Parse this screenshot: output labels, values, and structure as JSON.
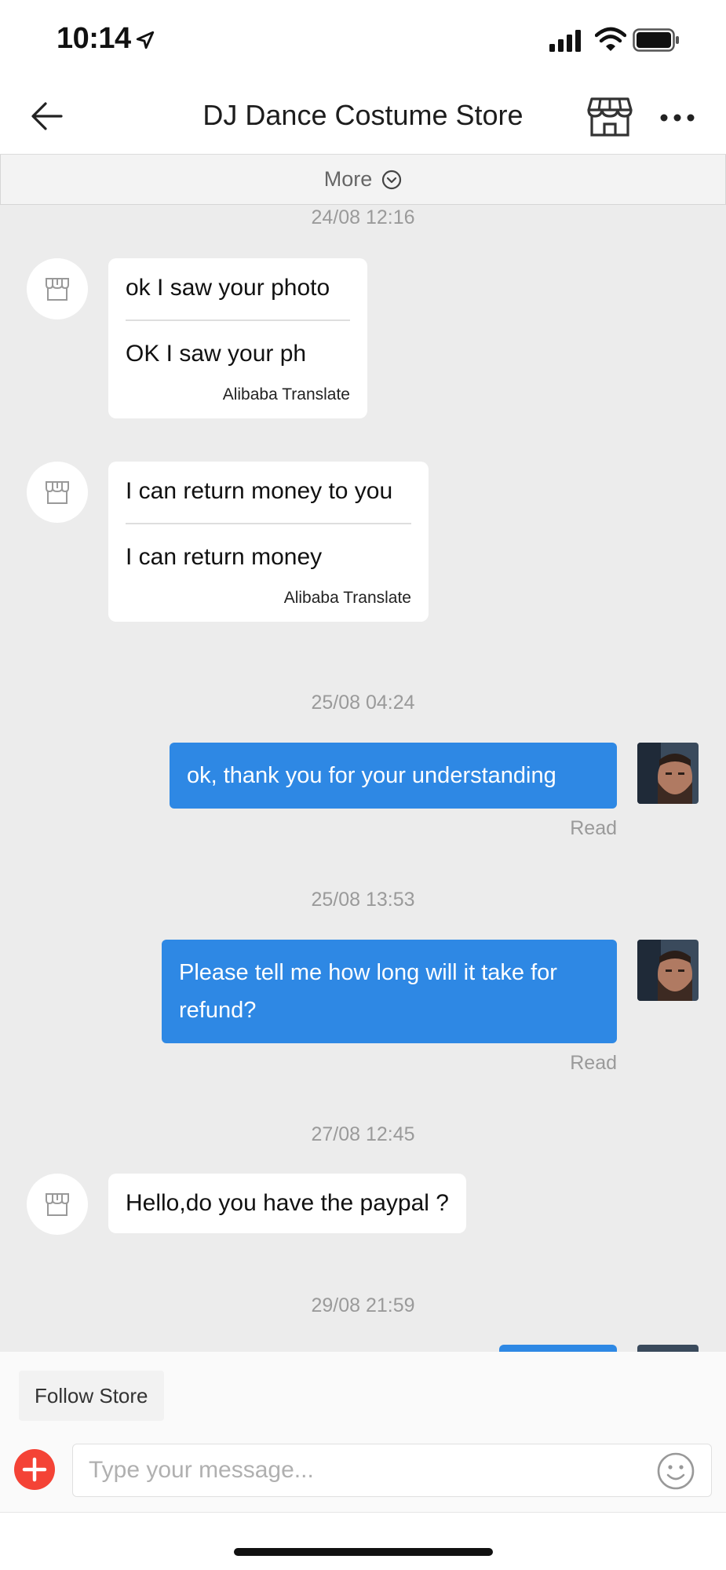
{
  "status_bar": {
    "time": "10:14"
  },
  "nav": {
    "title": "DJ Dance Costume Store"
  },
  "more_bar": {
    "label": "More"
  },
  "messages": {
    "ts1": "24/08 12:16",
    "m1": {
      "original": "ok I saw your photo",
      "translation": "OK I saw your ph",
      "translator": "Alibaba Translate"
    },
    "m2": {
      "original": "I can return money to you",
      "translation": "I can return money",
      "translator": "Alibaba Translate"
    },
    "ts2": "25/08 04:24",
    "m3": {
      "text": "ok, thank you for your understanding",
      "status": "Read"
    },
    "ts3": "25/08 13:53",
    "m4": {
      "text": "Please tell me how long will it take for refund?",
      "status": "Read"
    },
    "ts4": "27/08 12:45",
    "m5": {
      "text": "Hello,do you have the paypal ?"
    },
    "ts5": "29/08 21:59"
  },
  "footer": {
    "follow_label": "Follow Store",
    "input_placeholder": "Type your message..."
  },
  "colors": {
    "accent_blue": "#2e88e4",
    "add_red": "#f44336",
    "chat_bg": "#ececec"
  },
  "icons": [
    "location-arrow-icon",
    "signal-icon",
    "wifi-icon",
    "battery-icon",
    "back-arrow-icon",
    "store-icon",
    "more-dots-icon",
    "chevron-down-icon",
    "plus-icon",
    "emoji-icon"
  ]
}
